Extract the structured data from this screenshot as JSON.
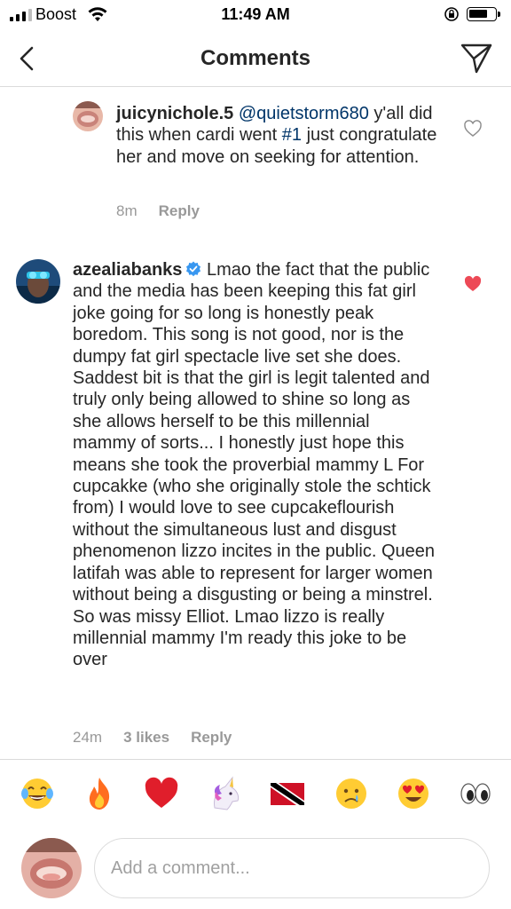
{
  "status": {
    "carrier": "Boost",
    "time": "11:49 AM",
    "battery_level": 0.7
  },
  "header": {
    "title": "Comments",
    "back_icon": "chevron-left-icon",
    "share_icon": "paper-plane-icon"
  },
  "comments": [
    {
      "username": "juicynichole.5",
      "mention": "@quietstorm680",
      "text_pre": " y'all did this when cardi went ",
      "hashtag": "#1",
      "text_post": " just congratulate her and move on seeking for attention.",
      "time": "8m",
      "reply_label": "Reply",
      "liked": false
    },
    {
      "username": "azealiabanks",
      "verified": true,
      "text": " Lmao the fact that the public and the media has been keeping this fat girl joke going for so long is honestly peak boredom. This song is not good, nor is the dumpy fat girl spectacle live set she does. Saddest bit is that the girl is legit talented and truly only being allowed to shine so long as she allows herself to be this millennial mammy of sorts... I honestly just hope this means she took the proverbial mammy L For cupcakke (who she originally stole the schtick from) I would love to see cupcakeflourish without the simultaneous lust and disgust phenomenon lizzo incites in the public. Queen latifah was able to represent for larger women without being a disgusting or being a minstrel. So was missy Elliot. Lmao lizzo is really millennial mammy I'm ready this joke to be over",
      "time": "24m",
      "likes_label": "3 likes",
      "reply_label": "Reply",
      "liked": true
    }
  ],
  "emoji_bar": [
    {
      "name": "tears-of-joy-emoji-icon"
    },
    {
      "name": "fire-emoji-icon"
    },
    {
      "name": "red-heart-emoji-icon"
    },
    {
      "name": "unicorn-emoji-icon"
    },
    {
      "name": "trinidad-flag-emoji-icon"
    },
    {
      "name": "crying-face-emoji-icon"
    },
    {
      "name": "heart-eyes-emoji-icon"
    },
    {
      "name": "eyes-emoji-icon"
    }
  ],
  "composer": {
    "placeholder": "Add a comment..."
  },
  "colors": {
    "heart_red": "#ed4956",
    "meta_gray": "#999999",
    "mention_blue": "#003569",
    "divider": "#dbdbdb"
  }
}
